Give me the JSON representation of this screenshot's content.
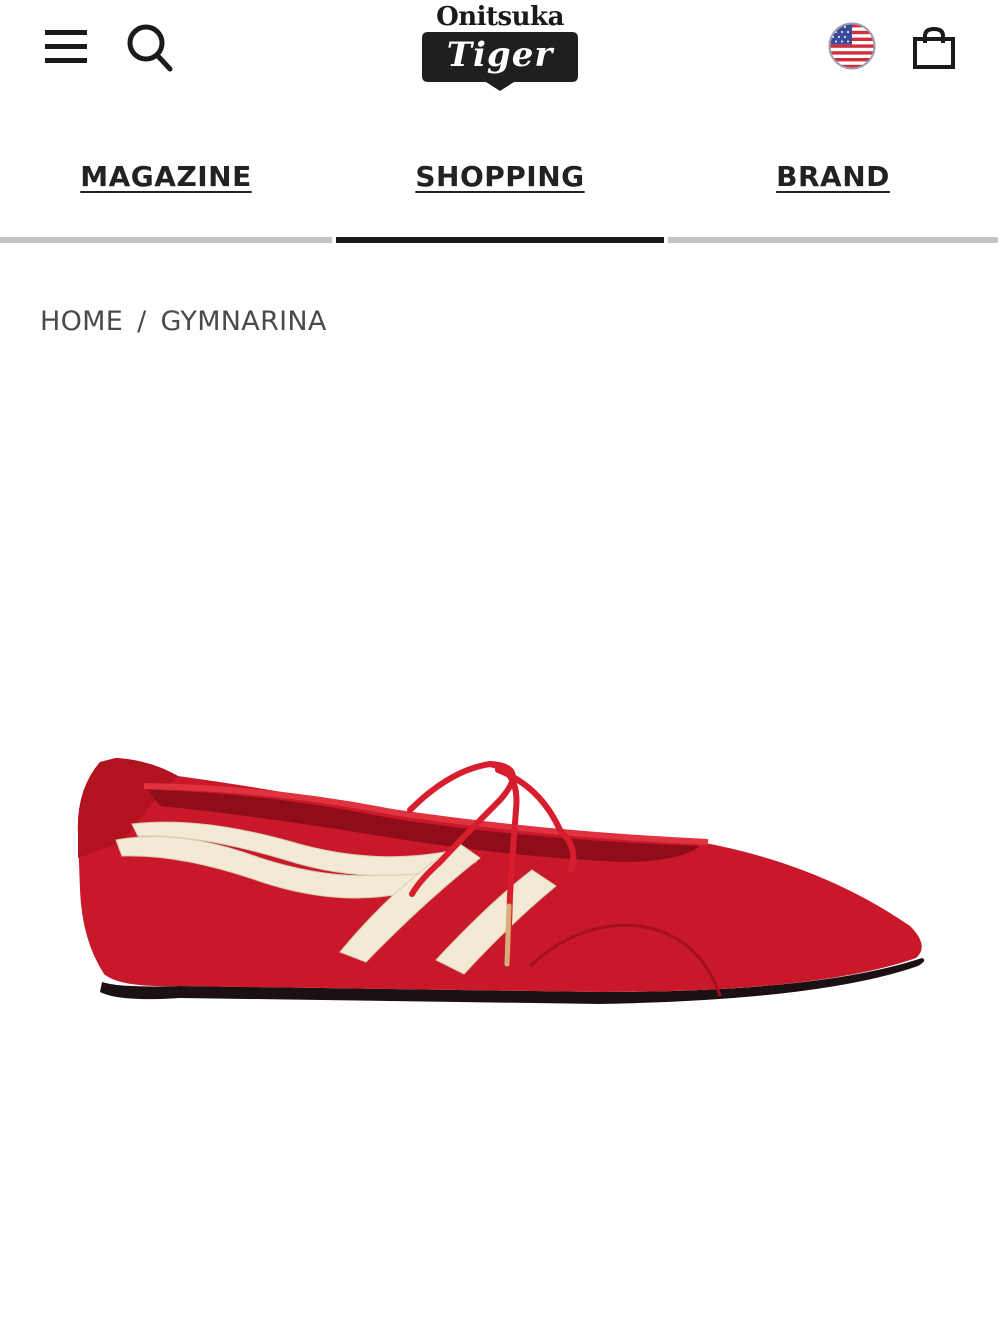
{
  "header": {
    "logo_top": "Onitsuka",
    "logo_bottom": "Tiger",
    "icons": {
      "menu": "hamburger-menu-icon",
      "search": "search-icon",
      "region": "us-flag-icon",
      "cart": "shopping-bag-icon"
    }
  },
  "nav": {
    "tabs": [
      {
        "label": "MAGAZINE",
        "active": false
      },
      {
        "label": "SHOPPING",
        "active": true
      },
      {
        "label": "BRAND",
        "active": false
      }
    ]
  },
  "breadcrumb": {
    "home": "HOME",
    "separator": "/",
    "current": "GYMNARINA"
  },
  "product": {
    "image": "red-leather-ballet-flat-with-cream-stripes"
  },
  "colors": {
    "text": "#222222",
    "active_tab_bar": "#1a1a1a",
    "inactive_tab_bar": "#c4c4c8",
    "product_red": "#c8182a",
    "stripe_cream": "#f3ead6"
  }
}
